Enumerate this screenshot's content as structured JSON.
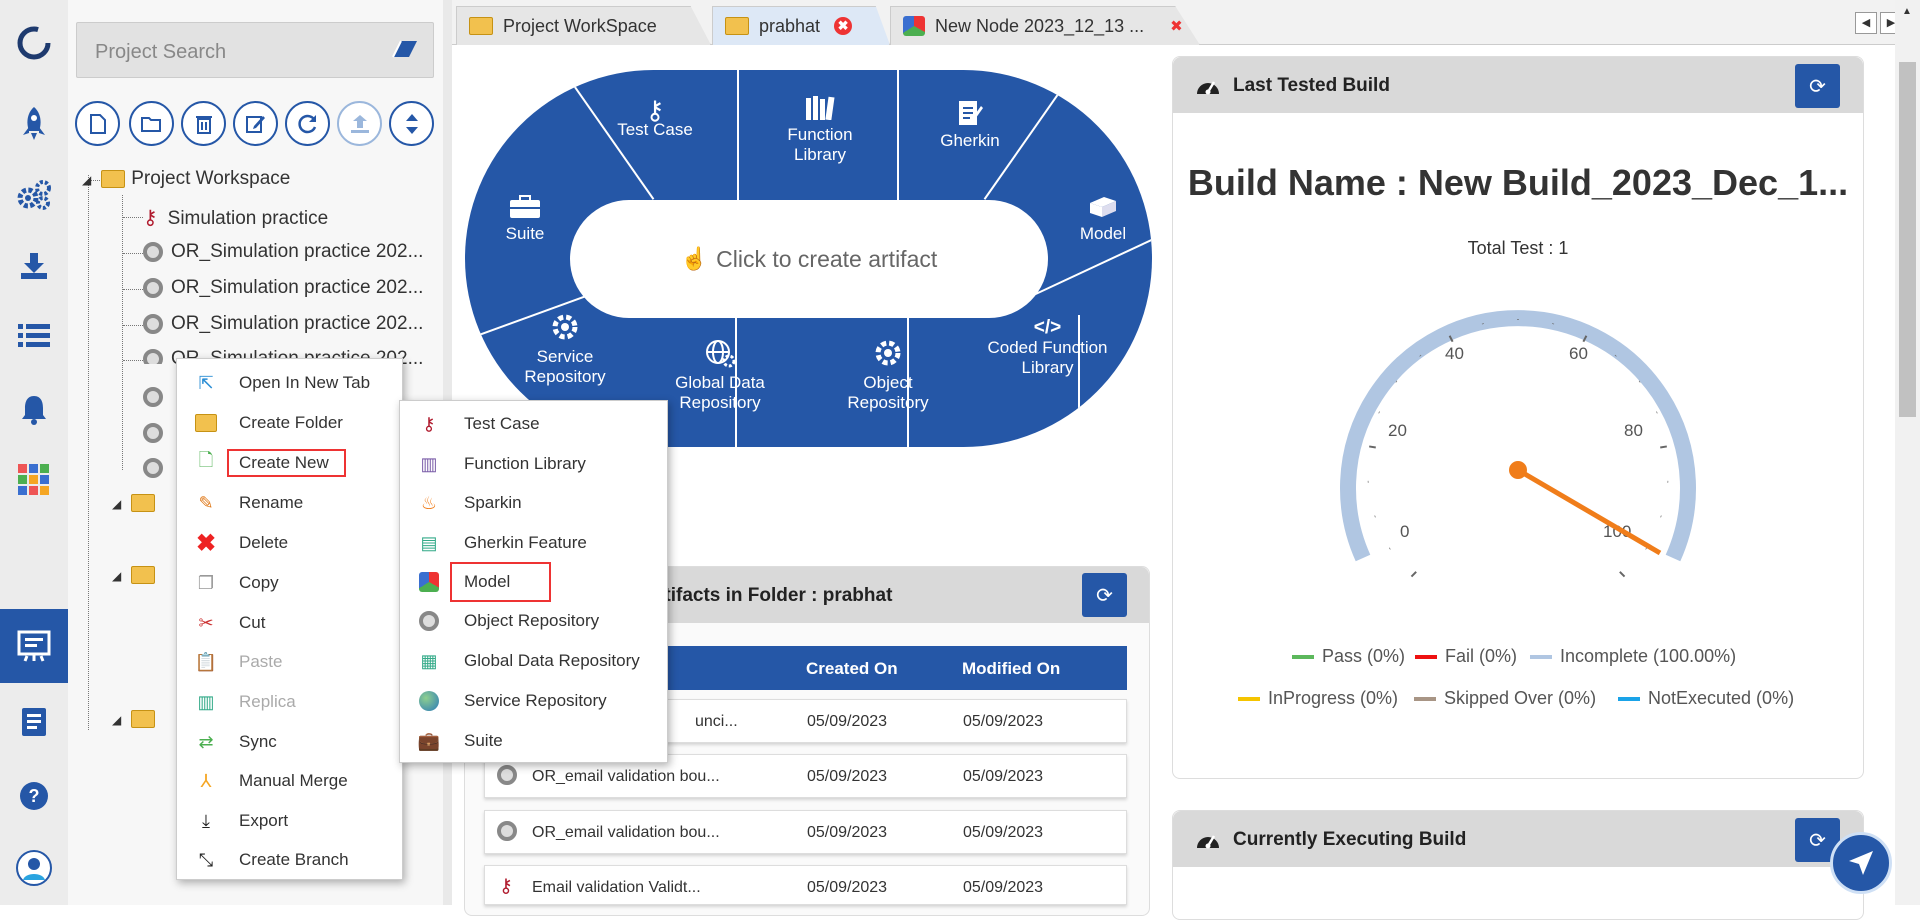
{
  "search": {
    "placeholder": "Project Search"
  },
  "tree": {
    "root": "Project Workspace",
    "items": [
      "Simulation practice",
      "OR_Simulation practice 202...",
      "OR_Simulation practice 202...",
      "OR_Simulation practice 202...",
      "OR_Simulation practice 202..."
    ]
  },
  "tabs": [
    {
      "label": "Project WorkSpace"
    },
    {
      "label": "prabhat",
      "close": "✖"
    },
    {
      "label": "New Node 2023_12_13 ...",
      "close": "✖"
    }
  ],
  "wheel": {
    "center": "Click to create artifact",
    "segments": {
      "test_case": "Test Case",
      "function_library": [
        "Function",
        "Library"
      ],
      "gherkin": "Gherkin",
      "suite": "Suite",
      "model": "Model",
      "service_repository": [
        "Service",
        "Repository"
      ],
      "global_data_repository": [
        "Global Data",
        "Repository"
      ],
      "object_repository": [
        "Object",
        "Repository"
      ],
      "coded_function_library": [
        "Coded Function",
        "Library"
      ]
    }
  },
  "context_menu": {
    "items": [
      {
        "label": "Open In New Tab",
        "icon": "open-new-tab-icon"
      },
      {
        "label": "Create Folder",
        "icon": "folder-icon"
      },
      {
        "label": "Create New",
        "icon": "create-new-icon"
      },
      {
        "label": "Rename",
        "icon": "rename-icon"
      },
      {
        "label": "Delete",
        "icon": "delete-icon"
      },
      {
        "label": "Copy",
        "icon": "copy-icon"
      },
      {
        "label": "Cut",
        "icon": "cut-icon"
      },
      {
        "label": "Paste",
        "icon": "paste-icon",
        "disabled": true
      },
      {
        "label": "Replica",
        "icon": "replica-icon",
        "disabled": true
      },
      {
        "label": "Sync",
        "icon": "sync-icon"
      },
      {
        "label": "Manual Merge",
        "icon": "merge-icon"
      },
      {
        "label": "Export",
        "icon": "export-icon"
      },
      {
        "label": "Create Branch",
        "icon": "branch-icon"
      }
    ]
  },
  "submenu": {
    "items": [
      {
        "label": "Test Case",
        "icon": "key-icon"
      },
      {
        "label": "Function Library",
        "icon": "library-icon"
      },
      {
        "label": "Sparkin",
        "icon": "flame-icon"
      },
      {
        "label": "Gherkin Feature",
        "icon": "scroll-icon"
      },
      {
        "label": "Model",
        "icon": "model-icon"
      },
      {
        "label": "Object Repository",
        "icon": "gear-icon"
      },
      {
        "label": "Global Data Repository",
        "icon": "spreadsheet-icon"
      },
      {
        "label": "Service Repository",
        "icon": "globe-icon"
      },
      {
        "label": "Suite",
        "icon": "briefcase-icon"
      }
    ]
  },
  "artifacts": {
    "title_visible": "rtifacts in Folder : prabhat",
    "columns": {
      "created": "Created On",
      "modified": "Modified On"
    },
    "rows": [
      {
        "name": "unci...",
        "created": "05/09/2023",
        "modified": "05/09/2023"
      },
      {
        "name": "OR_email validation bou...",
        "created": "05/09/2023",
        "modified": "05/09/2023"
      },
      {
        "name": "OR_email validation bou...",
        "created": "05/09/2023",
        "modified": "05/09/2023"
      },
      {
        "name": "Email validation Validt...",
        "created": "05/09/2023",
        "modified": "05/09/2023"
      }
    ]
  },
  "last_build": {
    "header": "Last Tested Build",
    "build_name": "Build Name : New Build_2023_Dec_1...",
    "total": "Total Test : 1",
    "gauge": {
      "ticks": [
        "0",
        "20",
        "40",
        "60",
        "80",
        "100"
      ],
      "value": 100
    },
    "legend": [
      {
        "label": "Pass (0%)",
        "color": "#5cb85c"
      },
      {
        "label": "Fail (0%)",
        "color": "#e11"
      },
      {
        "label": "Incomplete (100.00%)",
        "color": "#b0c6e2"
      },
      {
        "label": "InProgress (0%)",
        "color": "#f5c400"
      },
      {
        "label": "Skipped Over (0%)",
        "color": "#a89585"
      },
      {
        "label": "NotExecuted (0%)",
        "color": "#1aa3e8"
      }
    ]
  },
  "executing": {
    "header": "Currently Executing Build"
  },
  "colors": {
    "accent": "#2557a7",
    "highlight": "#e33"
  }
}
